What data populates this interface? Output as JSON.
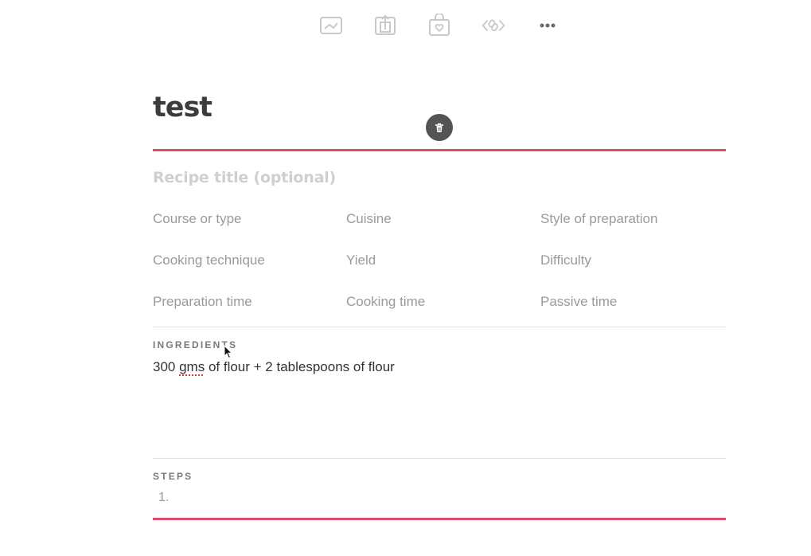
{
  "toolbar": {
    "icons": [
      "image-icon",
      "export-icon",
      "shop-bag-icon",
      "link-icon",
      "more-icon"
    ]
  },
  "note": {
    "title": "test"
  },
  "recipe": {
    "title_placeholder": "Recipe title (optional)",
    "fields": {
      "course": "Course or type",
      "cuisine": "Cuisine",
      "style": "Style of preparation",
      "technique": "Cooking technique",
      "yield": "Yield",
      "difficulty": "Difficulty",
      "prep_time": "Preparation time",
      "cook_time": "Cooking time",
      "passive_time": "Passive time"
    },
    "ingredients_label": "INGREDIENTS",
    "ingredients_text": {
      "before": "300 ",
      "misspelled": "gms",
      "after": " of flour + 2 tablespoons of flour"
    },
    "steps_label": "STEPS",
    "step_number": "1."
  },
  "colors": {
    "accent": "#dc4c6d",
    "placeholder": "#9a9a9a",
    "title": "#3c3c3c",
    "delete_button": "#545454"
  }
}
